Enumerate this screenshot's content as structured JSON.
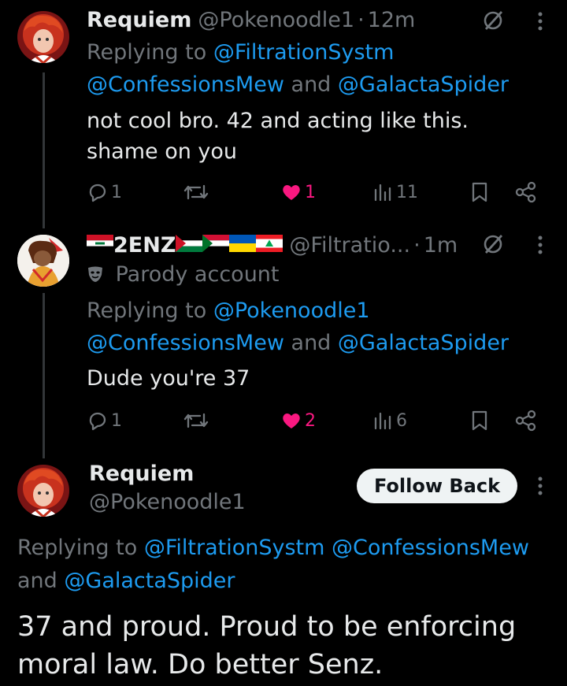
{
  "tweets": [
    {
      "name": "Requiem",
      "handle": "@Pokenoodle1",
      "time": "12m",
      "replying_prefix": "Replying to ",
      "reply_line1": "@FiltrationSystm",
      "reply_line2_a": "@ConfessionsMew",
      "reply_and": " and ",
      "reply_line2_b": "@GalactaSpider",
      "body": [
        "not cool bro. 42 and acting like this.",
        "shame on you"
      ],
      "replies": "1",
      "likes": "1",
      "views": "11"
    },
    {
      "name": "2ENZ",
      "handle": "@Filtratio...",
      "time": "1m",
      "parody_label": "Parody account",
      "replying_prefix": "Replying to ",
      "reply_line1": "@Pokenoodle1",
      "reply_line2_a": "@ConfessionsMew",
      "reply_and": " and ",
      "reply_line2_b": "@GalactaSpider",
      "body": [
        "Dude you're 37"
      ],
      "replies": "1",
      "likes": "2",
      "views": "6"
    }
  ],
  "main_tweet": {
    "name": "Requiem",
    "handle": "@Pokenoodle1",
    "follow_label": "Follow Back",
    "replying_prefix": "Replying to ",
    "reply_a": "@FiltrationSystm",
    "reply_b": "@ConfessionsMew",
    "reply_and": "and ",
    "reply_c": "@GalactaSpider",
    "body": [
      "37 and proud. Proud to be enforcing",
      "moral law. Do better Senz."
    ]
  },
  "colors": {
    "link": "#1d9bf0",
    "muted": "#71767b",
    "like": "#f91880",
    "text": "#e7e9ea"
  },
  "icons": [
    "grok-icon",
    "more-icon",
    "reply-icon",
    "retweet-icon",
    "heart-icon",
    "views-icon",
    "bookmark-icon",
    "share-icon",
    "parody-mask-icon"
  ]
}
